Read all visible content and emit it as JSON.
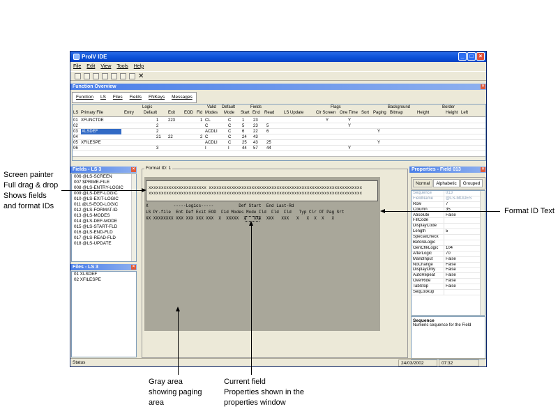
{
  "window": {
    "title": "ProIV IDE",
    "menu": [
      "File",
      "Edit",
      "View",
      "Tools",
      "Help"
    ],
    "toolbar_icons": [
      "open-icon",
      "save-icon",
      "edit-icon",
      "pencil-icon",
      "cut-icon",
      "copy-icon",
      "paste-icon",
      "delete-icon"
    ]
  },
  "function_overview": {
    "title": "Function Overview",
    "tabs": [
      "Function",
      "LS",
      "Files",
      "Fields",
      "FNKeys",
      "Messages"
    ],
    "group_headers": [
      "Logic",
      "Valid",
      "Default",
      "Fields",
      "Flags",
      "Background",
      "Border"
    ],
    "columns": [
      "LS",
      "Primary File",
      "Entry",
      "Default",
      "Exit",
      "EOD",
      "Fid",
      "Modes",
      "Mode",
      "Start",
      "End",
      "Read",
      "LS Update",
      "Clr Screen",
      "One Time",
      "Sort",
      "Paging",
      "Bitmap",
      "Height",
      "Height",
      "Left"
    ],
    "rows": [
      {
        "ls": "01",
        "file": "XFUNCTDE",
        "default": "1",
        "exit": "223",
        "fid": "1",
        "modes": "CL",
        "mode": "C",
        "start": "1",
        "end": "23",
        "read": "",
        "clr": "Y",
        "one": "Y",
        "paging": ""
      },
      {
        "ls": "02",
        "file": "",
        "default": "2",
        "exit": "",
        "fid": "",
        "modes": "C",
        "mode": "C",
        "start": "5",
        "end": "23",
        "read": "5",
        "clr": "",
        "one": "Y",
        "paging": ""
      },
      {
        "ls": "03",
        "file": "XLSDEF",
        "default": "2",
        "exit": "",
        "fid": "",
        "modes": "ACDLI",
        "mode": "C",
        "start": "6",
        "end": "22",
        "read": "6",
        "clr": "",
        "one": "",
        "paging": "Y"
      },
      {
        "ls": "04",
        "file": "",
        "default": "21",
        "exit": "22",
        "fid": "2",
        "modes": "C",
        "mode": "C",
        "start": "24",
        "end": "43",
        "read": "",
        "clr": "",
        "one": "",
        "paging": ""
      },
      {
        "ls": "05",
        "file": "XFILESPE",
        "default": "",
        "exit": "",
        "fid": "",
        "modes": "ACDLI",
        "mode": "C",
        "start": "25",
        "end": "43",
        "read": "25",
        "clr": "",
        "one": "",
        "paging": "Y"
      },
      {
        "ls": "06",
        "file": "",
        "default": "3",
        "exit": "",
        "fid": "",
        "modes": "I",
        "mode": "I",
        "start": "44",
        "end": "57",
        "read": "44",
        "clr": "",
        "one": "Y",
        "paging": ""
      }
    ]
  },
  "fields_panel": {
    "title": "Fields - LS 3",
    "items": [
      "006 @LS-SCREEN",
      "007 $PRIME-FILE",
      "008 @LS-ENTRY-LOGIC",
      "009 @LS-DEF-LOGIC",
      "010 @LS-EXIT-LOGIC",
      "011 @LS-EOD-LOGIC",
      "012 @LS-FORMAT-ID",
      "013 @LS-MODES",
      "014 @LS-DEF-MODE",
      "015 @LS-START-FLD",
      "016 @LS-END-FLD",
      "017 @LS-READ-FLD",
      "018 @LS-UPDATE"
    ]
  },
  "files_panel": {
    "title": "Files - LS 3",
    "items": [
      "01 XLSDEF",
      "02 XFILESPE"
    ]
  },
  "painter": {
    "format_id": "Format ID: 1",
    "row1": "xxxxxxxxxxxxxxxxxxxxxxx xxxxxxxxxxxxxxxxxxxxxxxxxxxxxxxxxxxxxxxxxxxxxxxxxxxxxxxxxxxxx",
    "row2": "xxxxxxxxxxxxxxxxxxxxxxxxxxxxxxxxxxxxxxxxxxxxxxxxxxxxxxxxxxxxxxxxxxxxxxxxxxxxxxxxxxxxx",
    "hdr1": "X          -----Logics-----          Def Start  End Last-Rd",
    "hdr2": "LS Pr-file  Ent Def Exit EOD  Fid Modes Mode Fld  Fld  Fld   Typ Clr OT Pag Srt",
    "data": "XX XXXXXXXX XXX XXX XXX XXX  X  XXXXX  X   XXX  XXX   XXX   X   X  X  X   X"
  },
  "properties": {
    "title": "Properties - Field 013",
    "tabs": [
      "Normal",
      "Alphabetic",
      "Grouped"
    ],
    "rows": [
      [
        "Sequence",
        "013"
      ],
      [
        "FieldName",
        "@LS-MODES"
      ],
      [
        "Row",
        "7"
      ],
      [
        "Column",
        "35"
      ],
      [
        "Absolute",
        "False"
      ],
      [
        "FillCode",
        ""
      ],
      [
        "DisplayCode",
        ""
      ],
      [
        "Length",
        "5"
      ],
      [
        "SpecialCheck",
        ""
      ],
      [
        "BeforeLogic",
        ""
      ],
      [
        "GenChkLogic",
        "104"
      ],
      [
        "AfterLogic",
        "70"
      ],
      [
        "MandInput",
        "False"
      ],
      [
        "NoChange",
        "False"
      ],
      [
        "DisplayOnly",
        "False"
      ],
      [
        "AutoRepeat",
        "False"
      ],
      [
        "OverRide",
        "False"
      ],
      [
        "TabStop",
        "False"
      ],
      [
        "SeqLookup",
        ""
      ]
    ],
    "desc_title": "Sequence",
    "desc_text": "Numeric sequence for the Field"
  },
  "status": {
    "text": "Status",
    "date": "24/03/2002",
    "time": "07:32"
  },
  "annotations": {
    "left": [
      "Screen painter",
      "Full drag & drop",
      "Shows fields",
      "and format IDs"
    ],
    "right": "Format ID Text",
    "bottom_left": [
      "Gray area",
      "showing paging",
      "area"
    ],
    "bottom_mid": [
      "Current field",
      "Properties shown in the",
      "properties window"
    ]
  }
}
